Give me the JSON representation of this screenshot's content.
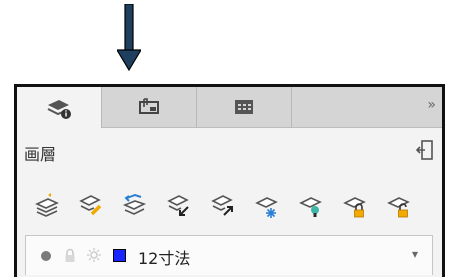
{
  "tabs": [
    {
      "icon": "layers-info-icon",
      "active": true
    },
    {
      "icon": "sheet-set-icon",
      "active": false
    },
    {
      "icon": "table-grid-icon",
      "active": false
    }
  ],
  "tab_overflow": "»",
  "panel_title": "画層",
  "layer_tools": [
    "layer-set-current-icon",
    "layer-match-icon",
    "layer-previous-icon",
    "layer-walk-down-icon",
    "layer-walk-up-icon",
    "layer-freeze-icon",
    "layer-isolate-icon",
    "layer-lock-icon",
    "layer-unlock-icon"
  ],
  "current_layer": {
    "name": "12寸法",
    "color": "#1a24ff"
  },
  "colors": {
    "accent_yellow": "#f2a900",
    "panel_bg": "#f3f3f3",
    "arrow": "#1f3f5f"
  }
}
